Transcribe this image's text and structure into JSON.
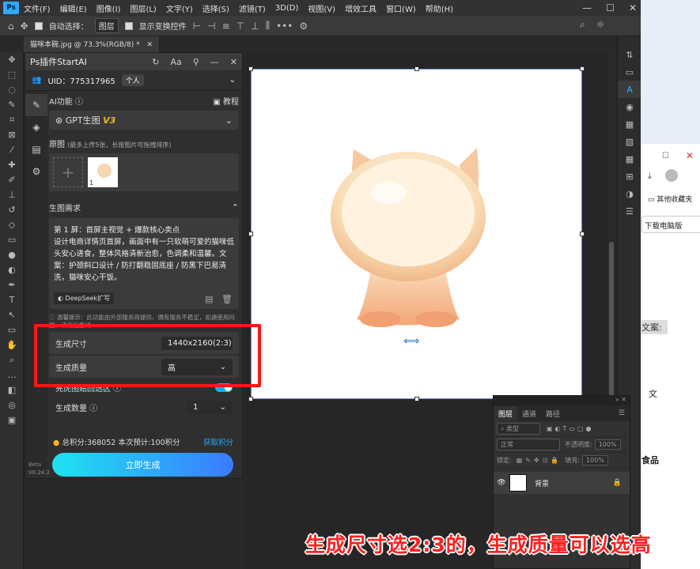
{
  "menubar": {
    "logo": "Ps",
    "items": [
      "文件(F)",
      "编辑(E)",
      "图像(I)",
      "图层(L)",
      "文字(Y)",
      "选择(S)",
      "滤镜(T)",
      "3D(D)",
      "视图(V)",
      "增效工具",
      "窗口(W)",
      "帮助(H)"
    ]
  },
  "options": {
    "auto_select_label": "自动选择：",
    "auto_select_value": "图层",
    "show_transform_label": "显示变换控件"
  },
  "document": {
    "tab_title": "猫咪本碗.jpg @ 73.3%(RGB/8) *"
  },
  "plugin": {
    "title": "Ps插件StartAI",
    "uid": "UID：775317965",
    "account_badge": "个人",
    "ai_function_label": "AI功能",
    "tutorial_label": "教程",
    "model_label": "GPT生图",
    "model_version": "V3",
    "source_label": "原图",
    "source_hint": "(最多上传5张，长按图片可拖拽排序)",
    "thumb_index": "1",
    "requirement_label": "生图需求",
    "prompt_text": "第 1 屏：首屏主视觉 + 爆款核心卖点\n设计电商详情页首屏，画面中有一只软萌可爱的猫咪低头安心进食，整体风格清新治愈，色调柔和温馨。文案：护颈斜口设计 / 防打翻稳固底座 / 防黑下巴易清洗，猫咪安心干饭。",
    "deepseek_label": "DeepSeek扩写",
    "warm_tip": "温馨提示：此功能由外部服务商提供，偶有服务不稳定，如遇使用问题，请稍后重试",
    "size_label": "生成尺寸",
    "size_value": "1440x2160(2:3)",
    "quality_label": "生成质量",
    "quality_value": "高",
    "region_label": "亮虎图贴回选区",
    "count_label": "生成数量",
    "count_value": "1",
    "points_text": "总积分:368052  本次预计:100积分",
    "get_points_label": "获取积分",
    "generate_button": "立即生成",
    "beta_label": "Beta",
    "version_label": "V0.24.2"
  },
  "layers_panel": {
    "tabs": [
      "图层",
      "通道",
      "路径"
    ],
    "filter_label": "类型",
    "blend_mode": "正常",
    "opacity_label": "不透明度:",
    "opacity_value": "100%",
    "lock_label": "锁定:",
    "fill_label": "填充:",
    "fill_value": "100%",
    "layer_name": "背景"
  },
  "browser": {
    "bookmarks_label": "其他收藏夹",
    "download_label": "下载电脑版",
    "text_1": "文案:",
    "text_2": "文",
    "text_3": "食品"
  },
  "caption": "生成尺寸选2:3的，生成质量可以选高",
  "colors": {
    "annotation_red": "#ff1515",
    "accent_blue": "#22a8ff",
    "model_version_gold": "#f5b623"
  }
}
